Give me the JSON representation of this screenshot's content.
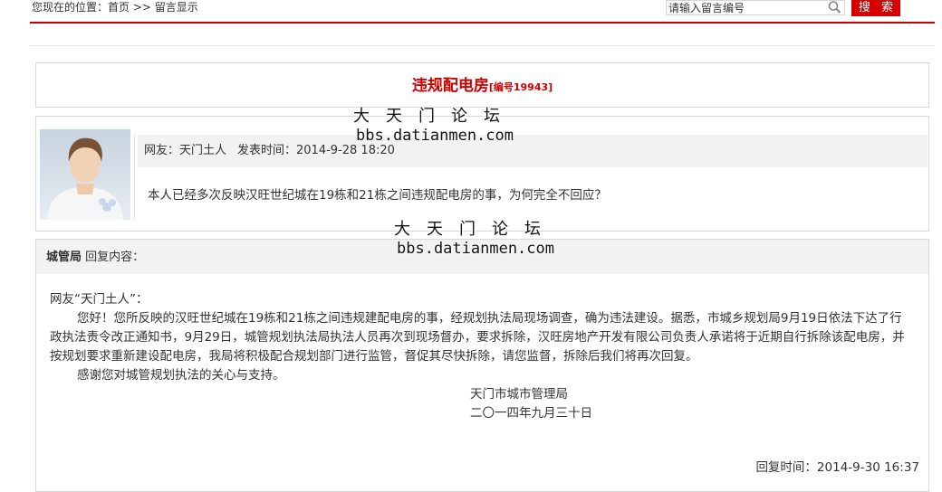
{
  "breadcrumb": {
    "prefix": "您现在的位置：",
    "home": "首页",
    "separator": " >> ",
    "current": "留言显示"
  },
  "search": {
    "placeholder": "请输入留言编号",
    "button_label": "搜 索"
  },
  "message": {
    "title": "违规配电房",
    "number_label": "[编号19943]"
  },
  "post": {
    "author_label": "网友：天门土人",
    "time_label": "发表时间：2014-9-28 18:20",
    "content": "本人已经多次反映汉旺世纪城在19栋和21栋之间违规配电房的事，为何完全不回应？"
  },
  "reply": {
    "department": "城管局",
    "header_suffix": " 回复内容：",
    "greeting": "网友“天门土人”：",
    "paragraph1": "您好！您所反映的汉旺世纪城在19栋和21栋之间违规建配电房的事，经规划执法局现场调查，确为违法建设。据悉，市城乡规划局9月19日依法下达了行政执法责令改正通知书，9月29日，城管规划执法局执法人员再次到现场督办，要求拆除，汉旺房地产开发有限公司负责人承诺将于近期自行拆除该配电房，并按规划要求重新建设配电房，我局将积极配合规划部门进行监管，督促其尽快拆除，请您监督，拆除后我们将再次回复。",
    "paragraph2": "感谢您对城管规划执法的关心与支持。",
    "signature": "天门市城市管理局",
    "date": "二〇一四年九月三十日",
    "reply_time": "回复时间：2014-9-30 16:37"
  },
  "watermark": {
    "name": "大天门论坛",
    "url": "bbs.datianmen.com"
  },
  "colors": {
    "accent": "#d10000",
    "search_button": "#d50000",
    "panel_bg": "#f2f2f2",
    "border": "#d8d8d8"
  }
}
